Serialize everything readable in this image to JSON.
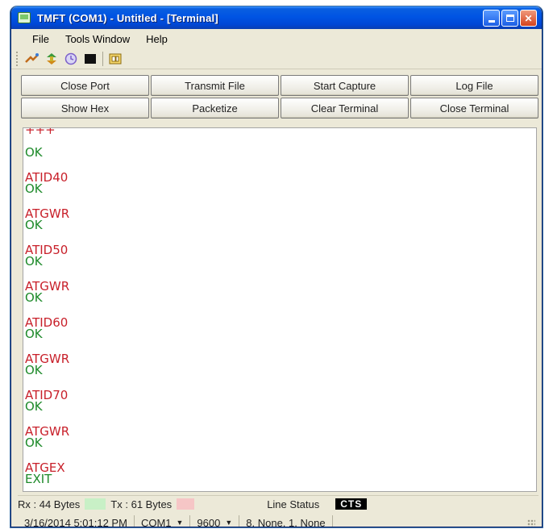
{
  "window": {
    "title": "TMFT (COM1) - Untitled - [Terminal]"
  },
  "menu": [
    "File",
    "Tools Window",
    "Help"
  ],
  "toolbar": {
    "icons": [
      "connect-icon",
      "transfer-icon",
      "timer-icon",
      "terminal-icon",
      "panel-icon"
    ]
  },
  "buttons": {
    "row1": [
      "Close Port",
      "Transmit File",
      "Start Capture",
      "Log File"
    ],
    "row2": [
      "Show Hex",
      "Packetize",
      "Clear Terminal",
      "Close Terminal"
    ]
  },
  "terminal": {
    "lines": [
      {
        "text": "+++",
        "kind": "tx"
      },
      {
        "text": "OK",
        "kind": "rx"
      },
      {
        "text": "ATID40",
        "kind": "tx"
      },
      {
        "text": "OK",
        "kind": "rx"
      },
      {
        "text": "ATGWR",
        "kind": "tx"
      },
      {
        "text": "OK",
        "kind": "rx"
      },
      {
        "text": "ATID50",
        "kind": "tx"
      },
      {
        "text": "OK",
        "kind": "rx"
      },
      {
        "text": "ATGWR",
        "kind": "tx"
      },
      {
        "text": "OK",
        "kind": "rx"
      },
      {
        "text": "ATID60",
        "kind": "tx"
      },
      {
        "text": "OK",
        "kind": "rx"
      },
      {
        "text": "ATGWR",
        "kind": "tx"
      },
      {
        "text": "OK",
        "kind": "rx"
      },
      {
        "text": "ATID70",
        "kind": "tx"
      },
      {
        "text": "OK",
        "kind": "rx"
      },
      {
        "text": "ATGWR",
        "kind": "tx"
      },
      {
        "text": "OK",
        "kind": "rx"
      },
      {
        "text": "ATGEX",
        "kind": "tx"
      },
      {
        "text": "EXIT",
        "kind": "rx"
      }
    ]
  },
  "status": {
    "rx": "Rx : 44 Bytes",
    "tx": "Tx : 61 Bytes",
    "line_status_label": "Line Status",
    "cts": "CTS",
    "datetime": "3/16/2014 5:01:12 PM",
    "port": "COM1",
    "baud": "9600",
    "settings": "8, None, 1, None"
  },
  "colors": {
    "tx_text": "#c8202a",
    "rx_text": "#1e8a2a",
    "titlebar": "#0054e3"
  }
}
